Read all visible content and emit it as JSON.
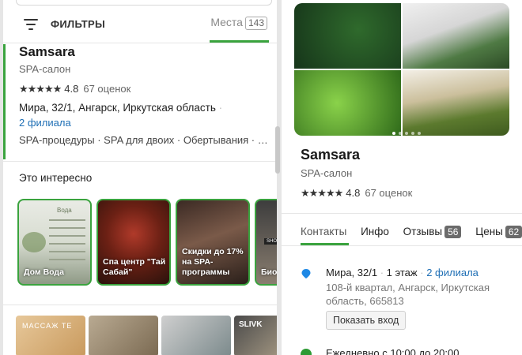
{
  "left_panel": {
    "filters_label": "ФИЛЬТРЫ",
    "places_label": "Места",
    "places_count": "143",
    "card": {
      "title": "Samsara",
      "subtitle": "SPA-салон",
      "stars": "★★★★★",
      "rating": "4.8",
      "reviews": "67 оценок",
      "address": "Мира, 32/1, Ангарск, Иркутская область",
      "address_dot": "·",
      "branches": "2 филиала",
      "tags": "SPA-процедуры · SPA для двоих · Обертывания · Массаж"
    },
    "interest": {
      "title": "Это интересно",
      "cards": [
        {
          "label": "Дом Вода",
          "header": "Вода"
        },
        {
          "label": "Спа центр \"Тай Сабай\""
        },
        {
          "label": "Скидки до 17% на SPA-программы"
        },
        {
          "label": "Биоп тали"
        }
      ]
    },
    "photo_thumbs": [
      {
        "caption": "МАССАЖ ТЕ"
      },
      {
        "caption": ""
      },
      {
        "caption": ""
      },
      {
        "caption": "SLIVK"
      }
    ]
  },
  "right_panel": {
    "title": "Samsara",
    "subtitle": "SPA-салон",
    "stars": "★★★★★",
    "rating": "4.8",
    "reviews": "67 оценок",
    "tabs": [
      {
        "label": "Контакты"
      },
      {
        "label": "Инфо"
      },
      {
        "label": "Отзывы",
        "badge": "56"
      },
      {
        "label": "Цены",
        "badge": "62"
      }
    ],
    "address_line1": "Мира, 32/1",
    "floor": "1 этаж",
    "dot": "·",
    "branches": "2 филиала",
    "address_line2": "108-й квартал, Ангарск, Иркутская область, 665813",
    "show_entry_button": "Показать вход",
    "hours": "Ежедневно с 10:00 до 20:00"
  },
  "colors": {
    "accent": "#3aa33e",
    "link": "#1f6fb5"
  }
}
